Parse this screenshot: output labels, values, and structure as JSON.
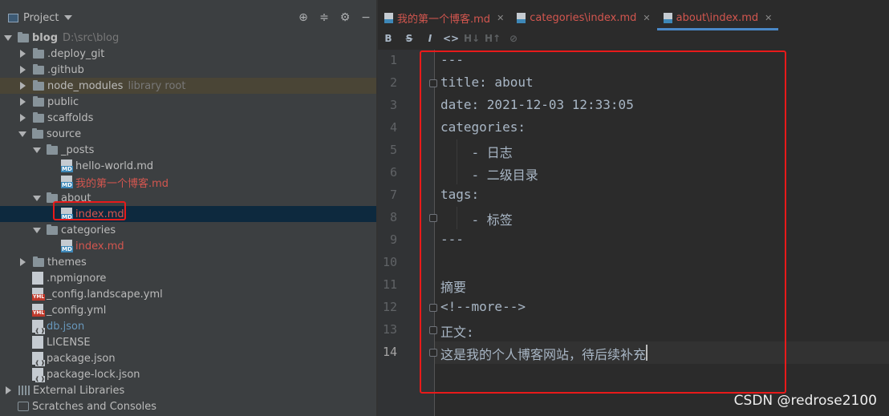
{
  "project_panel": {
    "title": "Project",
    "tools": [
      "locate-icon",
      "collapse-icon",
      "settings-icon",
      "hide-icon"
    ]
  },
  "tree": [
    {
      "label": "blog",
      "extra": "D:\\src\\blog",
      "kind": "folder",
      "state": "open",
      "depth": 0,
      "bold": true
    },
    {
      "label": ".deploy_git",
      "kind": "folder",
      "state": "closed",
      "depth": 1
    },
    {
      "label": ".github",
      "kind": "folder",
      "state": "closed",
      "depth": 1
    },
    {
      "label": "node_modules",
      "extra": "library root",
      "kind": "folder",
      "state": "closed",
      "depth": 1,
      "highlight": true
    },
    {
      "label": "public",
      "kind": "folder",
      "state": "closed",
      "depth": 1
    },
    {
      "label": "scaffolds",
      "kind": "folder",
      "state": "closed",
      "depth": 1
    },
    {
      "label": "source",
      "kind": "folder",
      "state": "open",
      "depth": 1
    },
    {
      "label": "_posts",
      "kind": "folder",
      "state": "open",
      "depth": 2
    },
    {
      "label": "hello-world.md",
      "kind": "md",
      "depth": 3
    },
    {
      "label": "我的第一个博客.md",
      "kind": "md",
      "depth": 3,
      "color": "red"
    },
    {
      "label": "about",
      "kind": "folder",
      "state": "open",
      "depth": 2
    },
    {
      "label": "index.md",
      "kind": "md",
      "depth": 3,
      "color": "red",
      "selected": true
    },
    {
      "label": "categories",
      "kind": "folder",
      "state": "open",
      "depth": 2
    },
    {
      "label": "index.md",
      "kind": "md",
      "depth": 3,
      "color": "red"
    },
    {
      "label": "themes",
      "kind": "folder",
      "state": "closed",
      "depth": 1
    },
    {
      "label": ".npmignore",
      "kind": "txt",
      "depth": 1
    },
    {
      "label": "_config.landscape.yml",
      "kind": "yml",
      "depth": 1
    },
    {
      "label": "_config.yml",
      "kind": "yml",
      "depth": 1
    },
    {
      "label": "db.json",
      "kind": "json",
      "depth": 1,
      "color": "blue"
    },
    {
      "label": "LICENSE",
      "kind": "txt",
      "depth": 1
    },
    {
      "label": "package.json",
      "kind": "json",
      "depth": 1
    },
    {
      "label": "package-lock.json",
      "kind": "json",
      "depth": 1
    },
    {
      "label": "External Libraries",
      "kind": "lib",
      "state": "closed",
      "depth": 0
    },
    {
      "label": "Scratches and Consoles",
      "kind": "scratch",
      "depth": 0
    }
  ],
  "tabs": [
    {
      "label": "我的第一个博客.md",
      "active": false
    },
    {
      "label": "categories\\index.md",
      "active": false
    },
    {
      "label": "about\\index.md",
      "active": true
    }
  ],
  "toolbar": [
    {
      "icon": "bold-icon",
      "glyph": "B",
      "enabled": true
    },
    {
      "icon": "strikethrough-icon",
      "glyph": "S",
      "enabled": true
    },
    {
      "icon": "italic-icon",
      "glyph": "I",
      "enabled": true
    },
    {
      "icon": "code-icon",
      "glyph": "<>",
      "enabled": true
    },
    {
      "icon": "header-decrease-icon",
      "glyph": "H↓",
      "enabled": false
    },
    {
      "icon": "header-increase-icon",
      "glyph": "H↑",
      "enabled": false
    },
    {
      "icon": "link-icon",
      "glyph": "⊘",
      "enabled": false
    }
  ],
  "editor": {
    "current_line": 14,
    "lines": [
      {
        "n": "1",
        "text": "---"
      },
      {
        "n": "2",
        "text": "title: about",
        "fold": true
      },
      {
        "n": "3",
        "text": "date: 2021-12-03 12:33:05"
      },
      {
        "n": "4",
        "text": "categories:"
      },
      {
        "n": "5",
        "text": "    - 日志"
      },
      {
        "n": "6",
        "text": "    - 二级目录"
      },
      {
        "n": "7",
        "text": "tags:"
      },
      {
        "n": "8",
        "text": "    - 标签",
        "fold": true
      },
      {
        "n": "9",
        "text": "---"
      },
      {
        "n": "10",
        "text": ""
      },
      {
        "n": "11",
        "text": "摘要"
      },
      {
        "n": "12",
        "text": "<!--more-->",
        "fold": true
      },
      {
        "n": "13",
        "text": "正文:",
        "fold": true
      },
      {
        "n": "14",
        "text": "这是我的个人博客网站，待后续补充",
        "fold": true
      }
    ]
  },
  "watermark": "CSDN @redrose2100"
}
